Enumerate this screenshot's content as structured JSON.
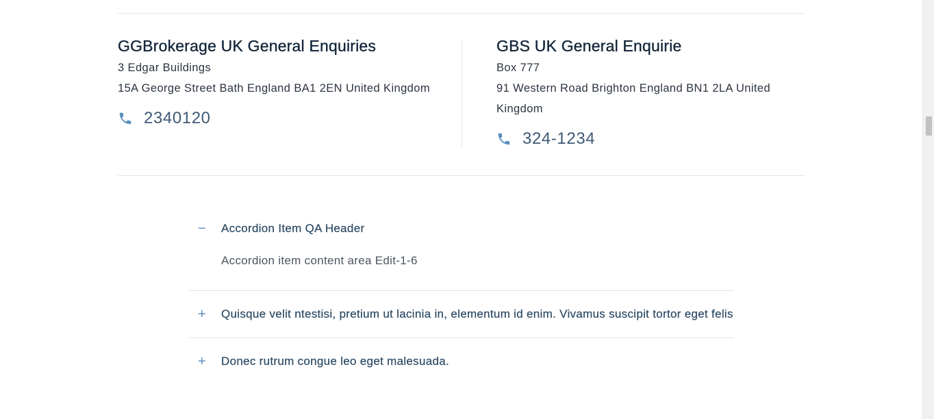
{
  "contacts": [
    {
      "title": "GGBrokerage UK General Enquiries",
      "address_line1": "3 Edgar Buildings",
      "address_line2": "15A George Street Bath England BA1 2EN United Kingdom",
      "phone": "2340120"
    },
    {
      "title": "GBS UK General Enquirie",
      "address_line1": "Box 777",
      "address_line2": "91 Western Road Brighton England BN1 2LA United Kingdom",
      "phone": "324-1234"
    }
  ],
  "accordion": {
    "items": [
      {
        "toggle": "−",
        "title": "Accordion Item QA Header",
        "expanded": true,
        "content": "Accordion item content area Edit-1-6"
      },
      {
        "toggle": "+",
        "title": "Quisque velit ntestisi, pretium ut lacinia in, elementum id enim. Vivamus suscipit tortor eget felis",
        "expanded": false
      },
      {
        "toggle": "+",
        "title": "Donec rutrum congue leo eget malesuada.",
        "expanded": false
      }
    ]
  },
  "colors": {
    "accent": "#5a8fbf",
    "title": "#13263a",
    "phone": "#3f5a75",
    "divider": "#e3e6e8"
  },
  "icons": {
    "phone": "phone-icon",
    "collapse": "minus-icon",
    "expand": "plus-icon"
  }
}
